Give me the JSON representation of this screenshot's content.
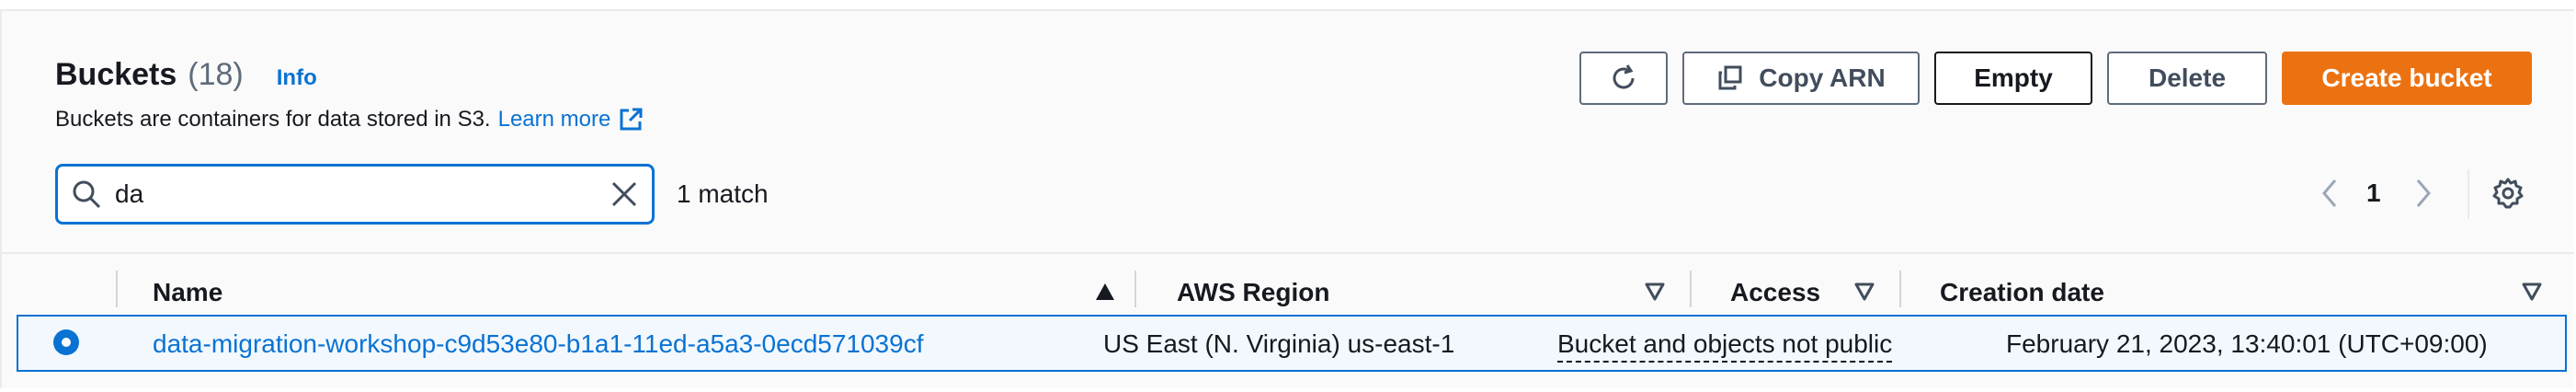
{
  "header": {
    "title": "Buckets",
    "count": "(18)",
    "info": "Info",
    "description": "Buckets are containers for data stored in S3.",
    "learn_more": "Learn more"
  },
  "toolbar": {
    "copy_arn": "Copy ARN",
    "empty": "Empty",
    "delete": "Delete",
    "create_bucket": "Create bucket"
  },
  "search": {
    "value": "da",
    "match_text": "1 match"
  },
  "pagination": {
    "current_page": "1"
  },
  "table": {
    "columns": {
      "name": "Name",
      "region": "AWS Region",
      "access": "Access",
      "creation_date": "Creation date"
    },
    "rows": [
      {
        "name": "data-migration-workshop-c9d53e80-b1a1-11ed-a5a3-0ecd571039cf",
        "region": "US East (N. Virginia) us-east-1",
        "access": "Bucket and objects not public",
        "creation_date": "February 21, 2023, 13:40:01 (UTC+09:00)"
      }
    ]
  },
  "colors": {
    "accent": "#0972d3",
    "primary_button": "#ec7211",
    "selected_row_bg": "#f2f8fd"
  }
}
